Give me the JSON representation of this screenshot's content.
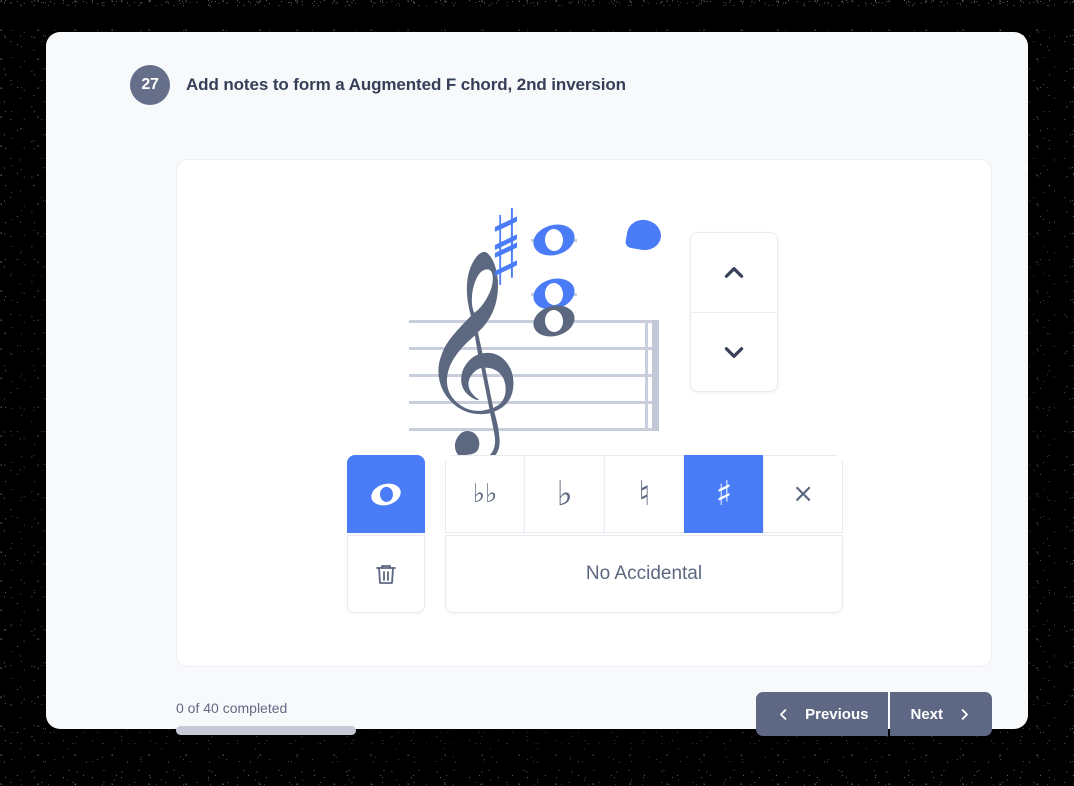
{
  "exercise": {
    "number": "27",
    "prompt": "Add notes to form a Augmented F chord, 2nd inversion"
  },
  "notation": {
    "clef_glyph": "𝄞",
    "clef_name": "treble-clef",
    "notes": [
      {
        "name": "note-top",
        "color": "#4b7cf8",
        "accidental": "♯",
        "on_ledger_line": true
      },
      {
        "name": "note-middle",
        "color": "#4b7cf8",
        "accidental": "♯",
        "on_ledger_line": true
      },
      {
        "name": "note-bottom",
        "color": "#5c6780",
        "accidental": "",
        "on_ledger_line": false
      }
    ],
    "staff_accidentals": [
      "♯",
      "♯"
    ],
    "cursor_indicator": "note-placement-cursor"
  },
  "stepper": {
    "up_label": "⌃",
    "down_label": "⌄"
  },
  "toolbar": {
    "notehead": {
      "label": "whole-note",
      "active": true
    },
    "delete_label": "delete",
    "accidentals": [
      {
        "name": "double-flat",
        "glyph": "𝄫",
        "fallback": "♭♭",
        "active": false
      },
      {
        "name": "flat",
        "glyph": "♭",
        "fallback": "♭",
        "active": false
      },
      {
        "name": "natural",
        "glyph": "♮",
        "fallback": "♮",
        "active": false
      },
      {
        "name": "sharp",
        "glyph": "♯",
        "fallback": "♯",
        "active": true
      },
      {
        "name": "double-sharp",
        "glyph": "𝄪",
        "fallback": "⨯",
        "active": false
      }
    ],
    "no_accidental_label": "No Accidental"
  },
  "footer": {
    "progress_text": "0 of 40 completed",
    "progress_percent": 0,
    "previous_label": "Previous",
    "next_label": "Next"
  },
  "colors": {
    "accent": "#4b7cf8",
    "slate": "#5c6780",
    "staff_line": "#c9cedd",
    "nav_button": "#5e6885",
    "badge": "#666f8a"
  }
}
